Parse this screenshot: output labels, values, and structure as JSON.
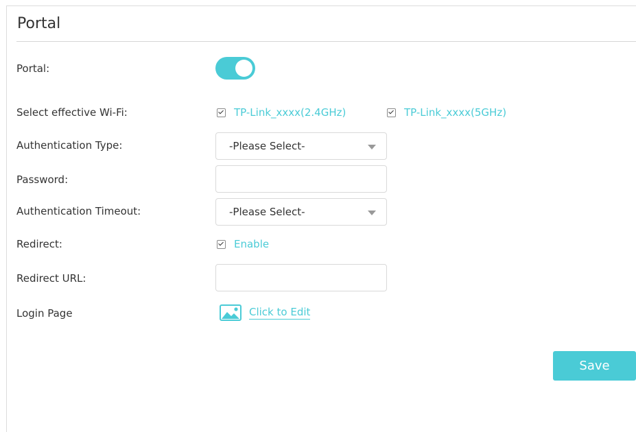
{
  "section": {
    "title": "Portal"
  },
  "fields": {
    "portal": {
      "label": "Portal:",
      "enabled": true
    },
    "wifi": {
      "label": "Select effective Wi-Fi:",
      "options": [
        {
          "label": "TP-Link_xxxx(2.4GHz)",
          "checked": true
        },
        {
          "label": "TP-Link_xxxx(5GHz)",
          "checked": true
        }
      ]
    },
    "auth_type": {
      "label": "Authentication Type:",
      "value": "-Please Select-"
    },
    "password": {
      "label": "Password:",
      "value": ""
    },
    "auth_timeout": {
      "label": "Authentication Timeout:",
      "value": "-Please Select-"
    },
    "redirect": {
      "label": "Redirect:",
      "option_label": "Enable",
      "checked": true
    },
    "redirect_url": {
      "label": "Redirect URL:",
      "value": ""
    },
    "login_page": {
      "label": "Login Page",
      "link_label": "Click to Edit",
      "icon": "image-icon"
    }
  },
  "actions": {
    "save_label": "Save"
  },
  "colors": {
    "accent": "#4acbd6",
    "text": "#333333",
    "border": "#d9d9d9"
  }
}
